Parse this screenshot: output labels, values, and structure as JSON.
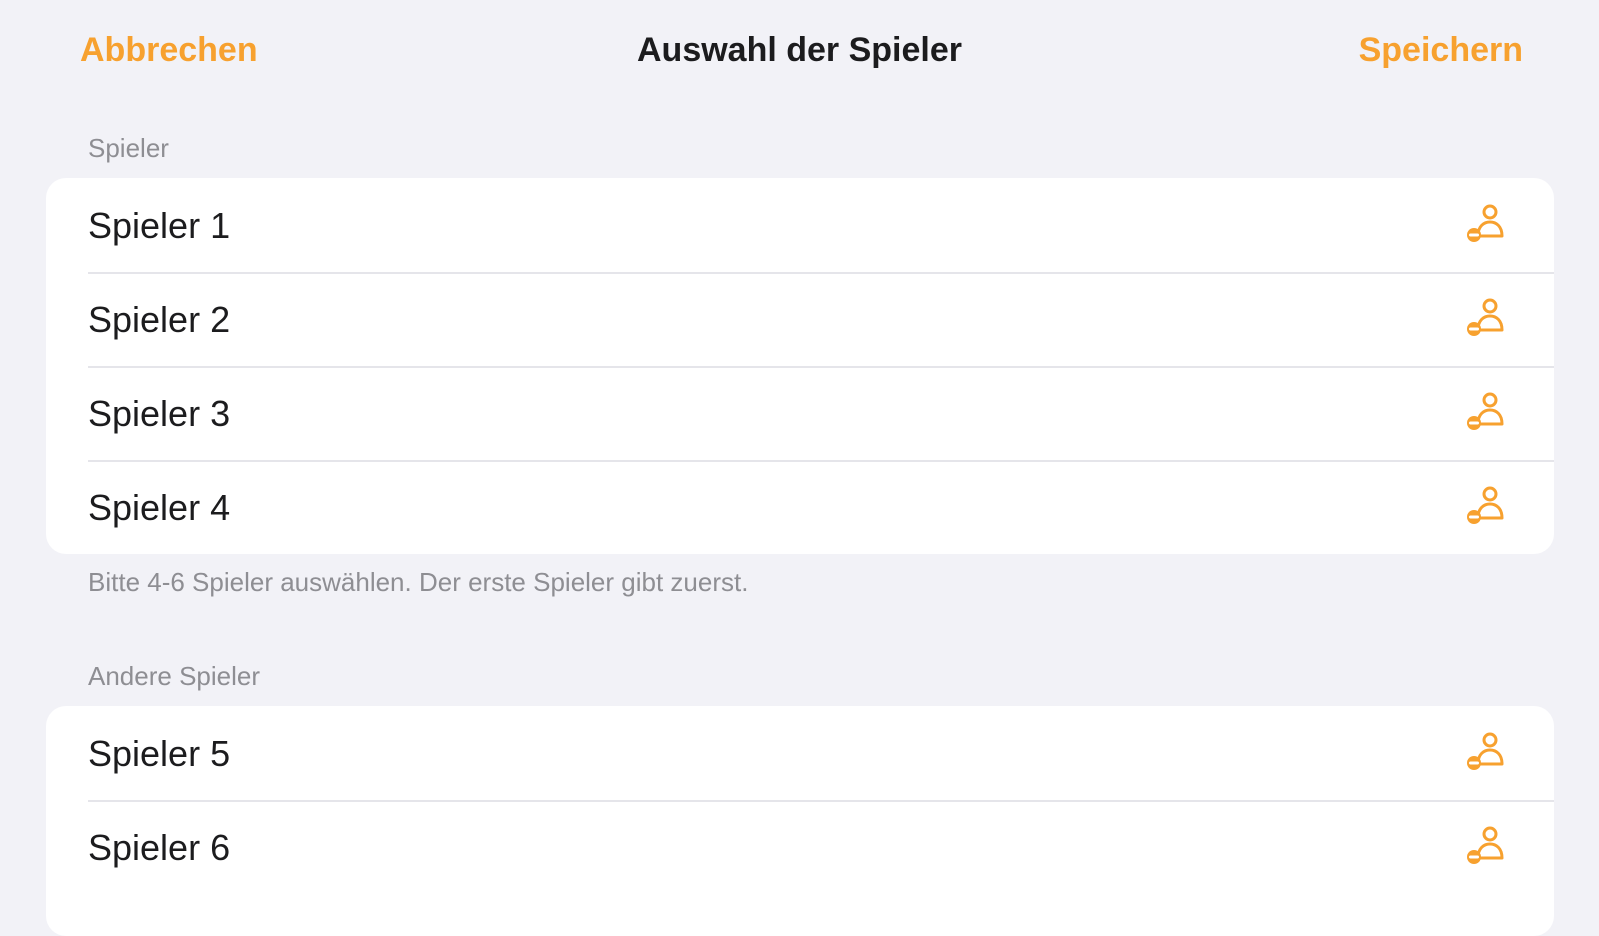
{
  "navbar": {
    "cancel_label": "Abbrechen",
    "title": "Auswahl der Spieler",
    "save_label": "Speichern"
  },
  "sections": [
    {
      "header": "Spieler",
      "footer": "Bitte 4-6 Spieler auswählen. Der erste Spieler gibt zuerst.",
      "rows": [
        {
          "label": "Spieler 1",
          "icon": "person-reorder-icon"
        },
        {
          "label": "Spieler 2",
          "icon": "person-reorder-icon"
        },
        {
          "label": "Spieler 3",
          "icon": "person-reorder-icon"
        },
        {
          "label": "Spieler 4",
          "icon": "person-reorder-icon"
        }
      ]
    },
    {
      "header": "Andere Spieler",
      "rows": [
        {
          "label": "Spieler 5",
          "icon": "person-reorder-icon"
        },
        {
          "label": "Spieler 6",
          "icon": "person-reorder-icon"
        }
      ]
    }
  ],
  "colors": {
    "accent": "#f7a12f",
    "background": "#f2f2f7",
    "text": "#1c1c1e",
    "secondary_text": "#8e8e93"
  }
}
